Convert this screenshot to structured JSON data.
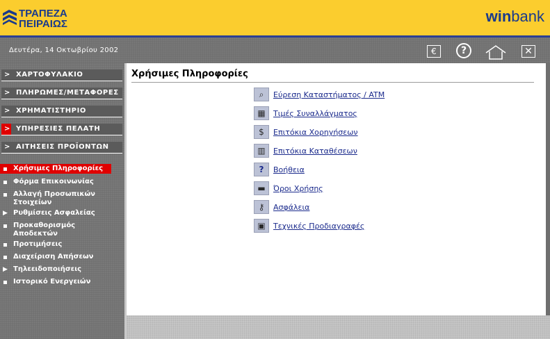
{
  "header": {
    "bank_name_line1": "ΤΡΑΠΕΖΑ",
    "bank_name_line2": "ΠΕΙΡΑΙΩΣ",
    "brand_win": "win",
    "brand_bank": "bank",
    "colors": {
      "header_bg": "#fbcd2e",
      "brand_blue": "#1a3a8c"
    }
  },
  "topbar": {
    "date": "Δευτέρα, 14 Οκτωβρίου 2002",
    "icons": [
      "euro-icon",
      "help-icon",
      "home-icon",
      "close-icon"
    ]
  },
  "sidebar": {
    "menu": [
      {
        "label": "ΧΑΡΤΟΦΥΛΑΚΙΟ",
        "active": false
      },
      {
        "label": "ΠΛΗΡΩΜΕΣ/ΜΕΤΑΦΟΡΕΣ",
        "active": false
      },
      {
        "label": "ΧΡΗΜΑΤΙΣΤΗΡΙΟ",
        "active": false
      },
      {
        "label": "ΥΠΗΡΕΣΙΕΣ ΠΕΛΑΤΗ",
        "active": true
      },
      {
        "label": "ΑΙΤΗΣΕΙΣ ΠΡΟΪΟΝΤΩΝ",
        "active": false
      }
    ],
    "submenu": [
      {
        "label": "Χρήσιμες Πληροφορίες",
        "marker": "bullet",
        "active": true
      },
      {
        "label": "Φόρμα Επικοινωνίας",
        "marker": "bullet",
        "active": false
      },
      {
        "label": "Αλλαγή Προσωπικών Στοιχείων",
        "marker": "bullet",
        "active": false
      },
      {
        "label": "Ρυθμίσεις Ασφαλείας",
        "marker": "triangle",
        "active": false
      },
      {
        "label": "Προκαθορισμός Αποδεκτών",
        "marker": "bullet",
        "active": false
      },
      {
        "label": "Προτιμήσεις",
        "marker": "bullet",
        "active": false
      },
      {
        "label": "Διαχείριση Απήσεων",
        "marker": "bullet",
        "active": false
      },
      {
        "label": "Τηλεειδοποιήσεις",
        "marker": "triangle",
        "active": false
      },
      {
        "label": "Ιστορικό Ενεργειών",
        "marker": "bullet",
        "active": false
      }
    ],
    "colors": {
      "active": "#e00000"
    }
  },
  "main": {
    "title": "Χρήσιμες Πληροφορίες",
    "links": [
      {
        "label": "Εύρεση Καταστήματος / ATM",
        "icon": "magnifier-icon"
      },
      {
        "label": "Τιμές Συναλλάγματος",
        "icon": "calculator-icon"
      },
      {
        "label": "Επιτόκια Χορηγήσεων",
        "icon": "money-icon"
      },
      {
        "label": "Επιτόκια Καταθέσεων",
        "icon": "savings-icon"
      },
      {
        "label": "Βοήθεια",
        "icon": "question-icon"
      },
      {
        "label": "Όροι Χρήσης",
        "icon": "folder-icon"
      },
      {
        "label": "Ασφάλεια",
        "icon": "key-icon"
      },
      {
        "label": "Τεχνικές Προδιαγραφές",
        "icon": "computer-icon"
      }
    ]
  }
}
